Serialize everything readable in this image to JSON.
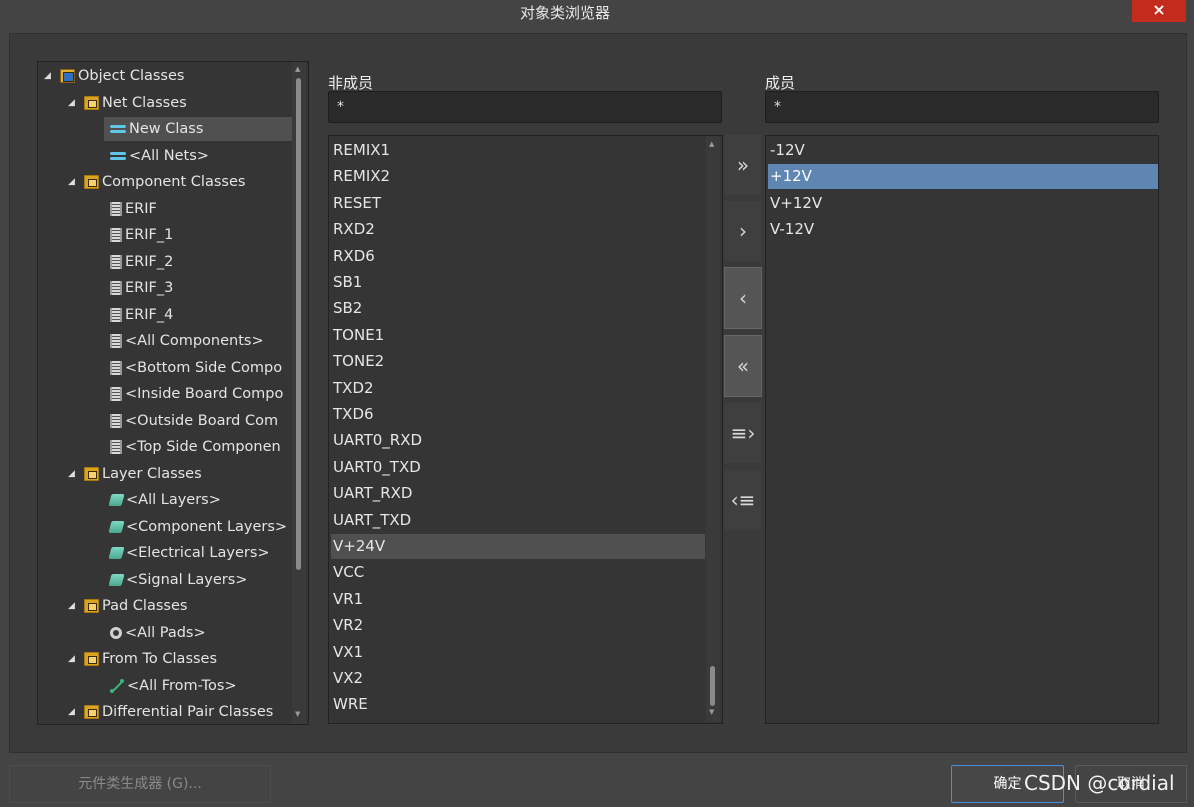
{
  "window": {
    "title": "对象类浏览器",
    "close_label": "×"
  },
  "tree": {
    "items": [
      {
        "label": "Object Classes",
        "icon": "folder-root-icon",
        "level": 0,
        "expanded": true
      },
      {
        "label": "Net Classes",
        "icon": "folder-icon",
        "level": 1,
        "expanded": true
      },
      {
        "label": "New Class",
        "icon": "net-icon",
        "level": 2,
        "selected": true
      },
      {
        "label": "<All Nets>",
        "icon": "net-icon",
        "level": 2
      },
      {
        "label": "Component Classes",
        "icon": "folder-icon",
        "level": 1,
        "expanded": true
      },
      {
        "label": "ERIF",
        "icon": "component-icon",
        "level": 2
      },
      {
        "label": "ERIF_1",
        "icon": "component-icon",
        "level": 2
      },
      {
        "label": "ERIF_2",
        "icon": "component-icon",
        "level": 2
      },
      {
        "label": "ERIF_3",
        "icon": "component-icon",
        "level": 2
      },
      {
        "label": "ERIF_4",
        "icon": "component-icon",
        "level": 2
      },
      {
        "label": "<All Components>",
        "icon": "component-icon",
        "level": 2
      },
      {
        "label": "<Bottom Side Compo",
        "icon": "component-icon",
        "level": 2
      },
      {
        "label": "<Inside Board Compo",
        "icon": "component-icon",
        "level": 2
      },
      {
        "label": "<Outside Board Com",
        "icon": "component-icon",
        "level": 2
      },
      {
        "label": "<Top Side Componen",
        "icon": "component-icon",
        "level": 2
      },
      {
        "label": "Layer Classes",
        "icon": "folder-icon",
        "level": 1,
        "expanded": true
      },
      {
        "label": "<All Layers>",
        "icon": "layer-icon",
        "level": 2
      },
      {
        "label": "<Component Layers>",
        "icon": "layer-icon",
        "level": 2
      },
      {
        "label": "<Electrical Layers>",
        "icon": "layer-icon",
        "level": 2
      },
      {
        "label": "<Signal Layers>",
        "icon": "layer-icon",
        "level": 2
      },
      {
        "label": "Pad Classes",
        "icon": "folder-icon",
        "level": 1,
        "expanded": true
      },
      {
        "label": "<All Pads>",
        "icon": "pad-icon",
        "level": 2
      },
      {
        "label": "From To Classes",
        "icon": "folder-icon",
        "level": 1,
        "expanded": true
      },
      {
        "label": "<All From-Tos>",
        "icon": "from-to-icon",
        "level": 2
      },
      {
        "label": "Differential Pair Classes",
        "icon": "folder-icon",
        "level": 1,
        "expanded": true
      }
    ]
  },
  "non_members": {
    "label": "非成员",
    "filter_value": "*",
    "items": [
      "REMIX1",
      "REMIX2",
      "RESET",
      "RXD2",
      "RXD6",
      "SB1",
      "SB2",
      "TONE1",
      "TONE2",
      "TXD2",
      "TXD6",
      "UART0_RXD",
      "UART0_TXD",
      "UART_RXD",
      "UART_TXD",
      "V+24V",
      "VCC",
      "VR1",
      "VR2",
      "VX1",
      "VX2",
      "WRE"
    ],
    "highlighted": "V+24V"
  },
  "members": {
    "label": "成员",
    "filter_value": "*",
    "items": [
      "-12V",
      "+12V",
      "V+12V",
      "V-12V"
    ],
    "selected": "+12V"
  },
  "transfer_buttons": [
    {
      "name": "add-all-button",
      "glyph": "»"
    },
    {
      "name": "add-selected-button",
      "glyph": "›"
    },
    {
      "name": "remove-selected-button",
      "glyph": "‹",
      "active": true
    },
    {
      "name": "remove-all-button",
      "glyph": "«",
      "active": true
    },
    {
      "name": "add-filtered-button",
      "glyph": "≡›"
    },
    {
      "name": "remove-filtered-button",
      "glyph": "‹≡"
    }
  ],
  "footer": {
    "generator_label": "元件类生成器 (G)...",
    "ok_label": "确定",
    "cancel_label": "取消",
    "watermark": "CSDN @cordial"
  },
  "colors": {
    "selection": "#5f86b3",
    "highlight": "#505050",
    "close": "#c42b1c",
    "ok_border": "#4a90d9"
  }
}
